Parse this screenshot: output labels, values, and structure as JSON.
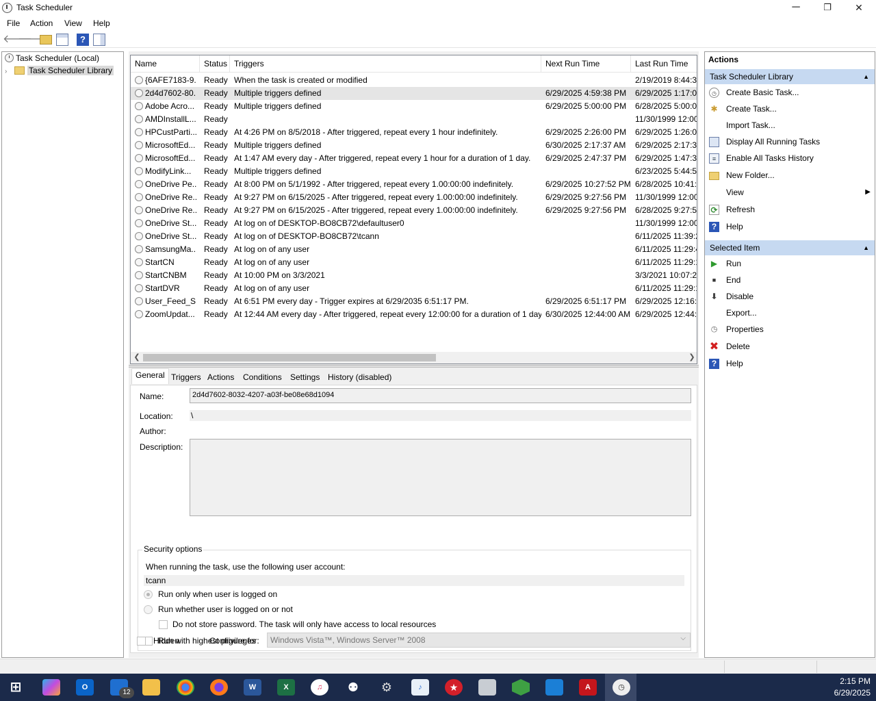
{
  "window": {
    "title": "Task Scheduler",
    "minimize": "─",
    "maximize": "❐",
    "close": "✕"
  },
  "menu": [
    "File",
    "Action",
    "View",
    "Help"
  ],
  "tree": {
    "root": "Task Scheduler (Local)",
    "library": "Task Scheduler Library"
  },
  "columns": [
    "Name",
    "Status",
    "Triggers",
    "Next Run Time",
    "Last Run Time"
  ],
  "tasks": [
    {
      "name": "{6AFE7183-9...",
      "status": "Ready",
      "trigger": "When the task is created or modified",
      "next": "",
      "last": "2/19/2019 8:44:37"
    },
    {
      "name": "2d4d7602-80...",
      "status": "Ready",
      "trigger": "Multiple triggers defined",
      "next": "6/29/2025 4:59:38 PM",
      "last": "6/29/2025 1:17:07"
    },
    {
      "name": "Adobe Acro...",
      "status": "Ready",
      "trigger": "Multiple triggers defined",
      "next": "6/29/2025 5:00:00 PM",
      "last": "6/28/2025 5:00:01"
    },
    {
      "name": "AMDInstallL...",
      "status": "Ready",
      "trigger": "",
      "next": "",
      "last": "11/30/1999 12:00:"
    },
    {
      "name": "HPCustParti...",
      "status": "Ready",
      "trigger": "At 4:26 PM on 8/5/2018 - After triggered, repeat every 1 hour indefinitely.",
      "next": "6/29/2025 2:26:00 PM",
      "last": "6/29/2025 1:26:01"
    },
    {
      "name": "MicrosoftEd...",
      "status": "Ready",
      "trigger": "Multiple triggers defined",
      "next": "6/30/2025 2:17:37 AM",
      "last": "6/29/2025 2:17:38"
    },
    {
      "name": "MicrosoftEd...",
      "status": "Ready",
      "trigger": "At 1:47 AM every day - After triggered, repeat every 1 hour for a duration of 1 day.",
      "next": "6/29/2025 2:47:37 PM",
      "last": "6/29/2025 1:47:39"
    },
    {
      "name": "ModifyLink...",
      "status": "Ready",
      "trigger": "Multiple triggers defined",
      "next": "",
      "last": "6/23/2025 5:44:54"
    },
    {
      "name": "OneDrive Pe...",
      "status": "Ready",
      "trigger": "At 8:00 PM on 5/1/1992 - After triggered, repeat every 1.00:00:00 indefinitely.",
      "next": "6/29/2025 10:27:52 PM",
      "last": "6/28/2025 10:41:5"
    },
    {
      "name": "OneDrive Re...",
      "status": "Ready",
      "trigger": "At 9:27 PM on 6/15/2025 - After triggered, repeat every 1.00:00:00 indefinitely.",
      "next": "6/29/2025 9:27:56 PM",
      "last": "11/30/1999 12:00:"
    },
    {
      "name": "OneDrive Re...",
      "status": "Ready",
      "trigger": "At 9:27 PM on 6/15/2025 - After triggered, repeat every 1.00:00:00 indefinitely.",
      "next": "6/29/2025 9:27:56 PM",
      "last": "6/28/2025 9:27:56"
    },
    {
      "name": "OneDrive St...",
      "status": "Ready",
      "trigger": "At log on of DESKTOP-BO8CB72\\defaultuser0",
      "next": "",
      "last": "11/30/1999 12:00:"
    },
    {
      "name": "OneDrive St...",
      "status": "Ready",
      "trigger": "At log on of DESKTOP-BO8CB72\\tcann",
      "next": "",
      "last": "6/11/2025 11:39:2"
    },
    {
      "name": "SamsungMa...",
      "status": "Ready",
      "trigger": "At log on of any user",
      "next": "",
      "last": "6/11/2025 11:29:4"
    },
    {
      "name": "StartCN",
      "status": "Ready",
      "trigger": "At log on of any user",
      "next": "",
      "last": "6/11/2025 11:29:1"
    },
    {
      "name": "StartCNBM",
      "status": "Ready",
      "trigger": "At 10:00 PM on 3/3/2021",
      "next": "",
      "last": "3/3/2021 10:07:27"
    },
    {
      "name": "StartDVR",
      "status": "Ready",
      "trigger": "At log on of any user",
      "next": "",
      "last": "6/11/2025 11:29:1"
    },
    {
      "name": "User_Feed_S...",
      "status": "Ready",
      "trigger": "At 6:51 PM every day - Trigger expires at 6/29/2035 6:51:17 PM.",
      "next": "6/29/2025 6:51:17 PM",
      "last": "6/29/2025 12:16:5"
    },
    {
      "name": "ZoomUpdat...",
      "status": "Ready",
      "trigger": "At 12:44 AM every day - After triggered, repeat every 12:00:00 for a duration of 1 day.",
      "next": "6/30/2025 12:44:00 AM",
      "last": "6/29/2025 12:44:0"
    }
  ],
  "details": {
    "tabs": [
      "General",
      "Triggers",
      "Actions",
      "Conditions",
      "Settings",
      "History (disabled)"
    ],
    "name_label": "Name:",
    "name_value": "2d4d7602-8032-4207-a03f-be08e68d1094",
    "location_label": "Location:",
    "location_value": "\\",
    "author_label": "Author:",
    "author_value": "",
    "description_label": "Description:",
    "description_value": "",
    "security_title": "Security options",
    "account_prompt": "When running the task, use the following user account:",
    "account": "tcann",
    "radio1": "Run only when user is logged on",
    "radio2": "Run whether user is logged on or not",
    "nostore": "Do not store password.  The task will only have access to local resources",
    "highest": "Run with highest privileges",
    "hidden": "Hidden",
    "configure_label": "Configure for:",
    "configure_value": "Windows Vista™, Windows Server™ 2008"
  },
  "actions": {
    "header": "Actions",
    "section1": "Task Scheduler Library",
    "items1": [
      "Create Basic Task...",
      "Create Task...",
      "Import Task...",
      "Display All Running Tasks",
      "Enable All Tasks History",
      "New Folder...",
      "View",
      "Refresh",
      "Help"
    ],
    "section2": "Selected Item",
    "items2": [
      "Run",
      "End",
      "Disable",
      "Export...",
      "Properties",
      "Delete",
      "Help"
    ]
  },
  "taskbar": {
    "badge": "12",
    "time": "2:15 PM",
    "date": "6/29/2025"
  },
  "colors": {
    "section": "#c6d9f1",
    "taskbar": "#1b2a4a",
    "selected_row": "#e5e5e5"
  }
}
